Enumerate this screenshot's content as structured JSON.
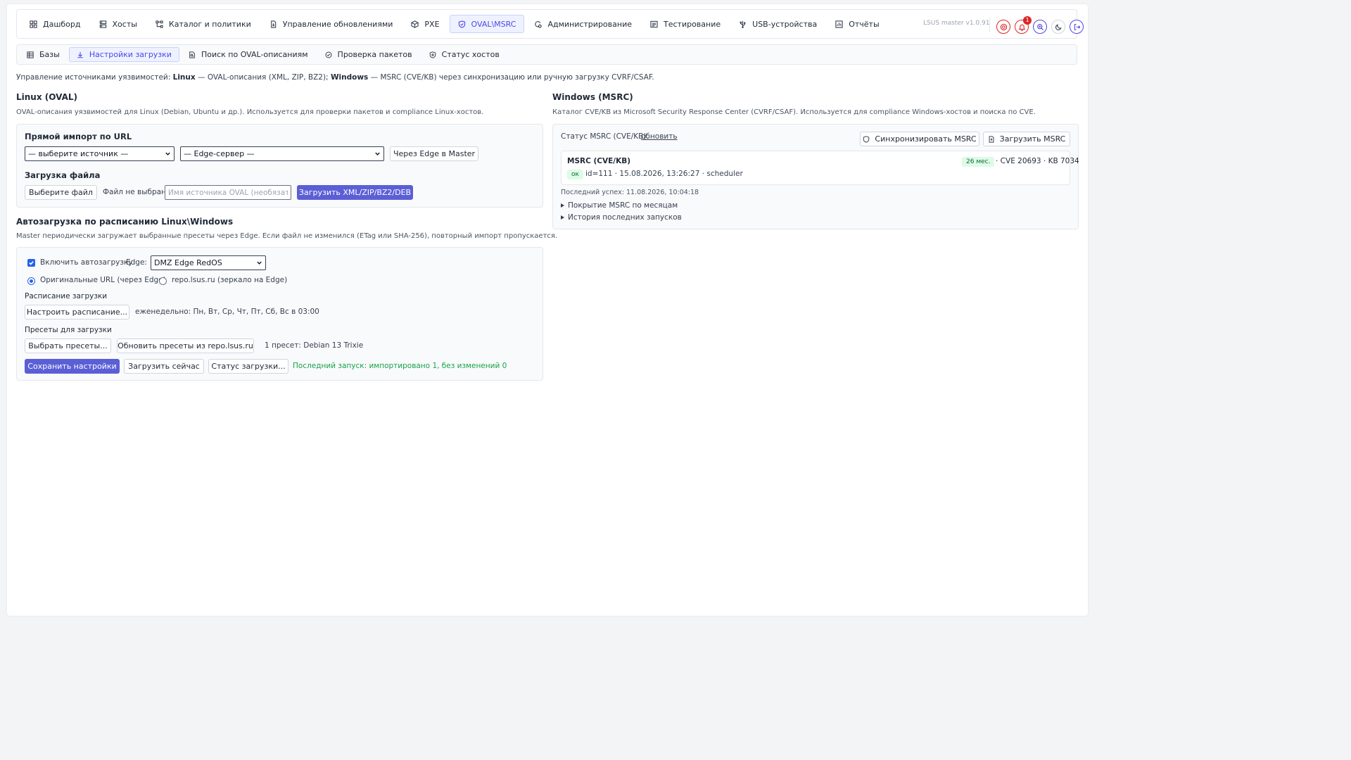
{
  "nav": {
    "items": [
      {
        "label": "Дашборд",
        "icon": "grid-icon",
        "active": false
      },
      {
        "label": "Хосты",
        "icon": "server-icon",
        "active": false
      },
      {
        "label": "Каталог и политики",
        "icon": "network-icon",
        "active": false
      },
      {
        "label": "Управление обновлениями",
        "icon": "file-update-icon",
        "active": false
      },
      {
        "label": "PXE",
        "icon": "box-icon",
        "active": false
      },
      {
        "label": "OVAL\\MSRC",
        "icon": "shield-icon",
        "active": true
      },
      {
        "label": "Администрирование",
        "icon": "admin-icon",
        "active": false
      },
      {
        "label": "Тестирование",
        "icon": "test-icon",
        "active": false
      },
      {
        "label": "USB-устройства",
        "icon": "usb-icon",
        "active": false
      },
      {
        "label": "Отчёты",
        "icon": "report-icon",
        "active": false
      }
    ],
    "version": "LSUS master v1.0.91",
    "notifications_count": "1"
  },
  "subnav": {
    "items": [
      {
        "label": "Базы",
        "icon": "database-icon",
        "active": false
      },
      {
        "label": "Настройки загрузки",
        "icon": "download-icon",
        "active": true
      },
      {
        "label": "Поиск по OVAL-описаниям",
        "icon": "document-search-icon",
        "active": false
      },
      {
        "label": "Проверка пакетов",
        "icon": "check-circle-icon",
        "active": false
      },
      {
        "label": "Статус хостов",
        "icon": "shield-check-icon",
        "active": false
      }
    ]
  },
  "intro": {
    "prefix": "Управление источниками уязвимостей: ",
    "linux": "Linux",
    "middle": " — OVAL-описания (XML, ZIP, BZ2); ",
    "windows": "Windows",
    "suffix": " — MSRC (CVE/KB) через синхронизацию или ручную загрузку CVRF/CSAF."
  },
  "linux": {
    "title": "Linux (OVAL)",
    "desc": "OVAL-описания уязвимостей для Linux (Debian, Ubuntu и др.). Используется для проверки пакетов и compliance Linux-хостов.",
    "url_import": {
      "title": "Прямой импорт по URL",
      "source_select": "— выберите источник —",
      "edge_select": "— Edge-сервер —",
      "via_edge_button": "Через Edge в Master"
    },
    "file_upload": {
      "title": "Загрузка файла",
      "choose_button": "Выберите файл",
      "no_file": "Файл не выбран",
      "name_placeholder": "Имя источника OVAL (необязательно)",
      "upload_button": "Загрузить XML/ZIP/BZ2/DEB"
    }
  },
  "autoload": {
    "title": "Автозагрузка по расписанию Linux\\Windows",
    "desc": "Master периодически загружает выбранные пресеты через Edge. Если файл не изменился (ETag или SHA-256), повторный импорт пропускается.",
    "enable_label": "Включить автозагрузку",
    "enable_checked": true,
    "edge_label": "Edge:",
    "edge_value": "DMZ Edge RedOS",
    "radio_original": "Оригинальные URL (через Edge)",
    "radio_mirror": "repo.lsus.ru (зеркало на Edge)",
    "schedule_title": "Расписание загрузки",
    "schedule_button": "Настроить расписание...",
    "schedule_value": "еженедельно: Пн, Вт, Ср, Чт, Пт, Сб, Вс в 03:00",
    "presets_title": "Пресеты для загрузки",
    "choose_presets_button": "Выбрать пресеты...",
    "update_presets_button": "Обновить пресеты из repo.lsus.ru",
    "presets_value": "1 пресет: Debian 13 Trixie",
    "save_button": "Сохранить настройки",
    "load_now_button": "Загрузить сейчас",
    "status_button": "Статус загрузки...",
    "last_run": "Последний запуск: импортировано 1, без изменений 0"
  },
  "windows": {
    "title": "Windows (MSRC)",
    "desc": "Каталог CVE/KB из Microsoft Security Response Center (CVRF/CSAF). Используется для compliance Windows-хостов и поиска по CVE.",
    "status_label": "Статус MSRC (CVE/KB).",
    "refresh_link": "обновить",
    "sync_button": "Синхронизировать MSRC",
    "upload_button": "Загрузить MSRC",
    "card": {
      "title": "MSRC (CVE/KB)",
      "months_badge": "26 мес.",
      "counts": "· CVE 20693 · KB 7034",
      "status_badge": "ок",
      "meta": "id=111 · 15.08.2026, 13:26:27 · scheduler"
    },
    "last_success": "Последний успех: 11.08.2026, 10:04:18",
    "coverage_details": "Покрытие MSRC по месяцам",
    "history_details": "История последних запусков"
  }
}
